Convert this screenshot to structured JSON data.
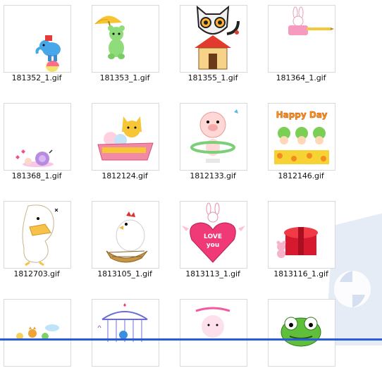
{
  "gallery": {
    "items": [
      {
        "name": "181352_1.gif",
        "art": "elephant-on-ball-icon"
      },
      {
        "name": "181353_1.gif",
        "art": "bear-umbrella-icon"
      },
      {
        "name": "181355_1.gif",
        "art": "cat-doghouse-icon"
      },
      {
        "name": "181364_1.gif",
        "art": "bunny-pencil-icon"
      },
      {
        "name": "181368_1.gif",
        "art": "snail-hearts-icon"
      },
      {
        "name": "1812124.gif",
        "art": "cat-yarn-basket-icon"
      },
      {
        "name": "1812133.gif",
        "art": "pig-hula-hoop-icon"
      },
      {
        "name": "1812146.gif",
        "art": "happy-day-frogs-icon"
      },
      {
        "name": "1812703.gif",
        "art": "duck-icon"
      },
      {
        "name": "1813105_1.gif",
        "art": "hen-nest-icon"
      },
      {
        "name": "1813113_1.gif",
        "art": "love-you-heart-icon"
      },
      {
        "name": "1813116_1.gif",
        "art": "gift-box-icon"
      },
      {
        "name": "",
        "art": "cat-cloud-icon"
      },
      {
        "name": "",
        "art": "music-cage-icon"
      },
      {
        "name": "",
        "art": "pink-character-icon"
      },
      {
        "name": "",
        "art": "green-frog-icon"
      }
    ],
    "labels": {
      "happy_day": "Happy Day",
      "love": "LOVE",
      "you": "you"
    }
  }
}
